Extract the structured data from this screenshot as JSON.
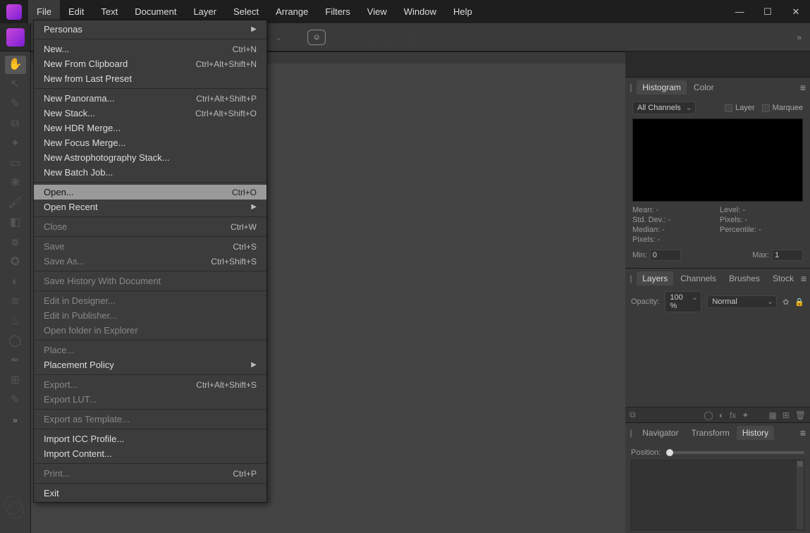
{
  "menubar": [
    "File",
    "Edit",
    "Text",
    "Document",
    "Layer",
    "Select",
    "Arrange",
    "Filters",
    "View",
    "Window",
    "Help"
  ],
  "dropdown": {
    "groups": [
      [
        {
          "label": "Personas",
          "submenu": true
        }
      ],
      [
        {
          "label": "New...",
          "shortcut": "Ctrl+N"
        },
        {
          "label": "New From Clipboard",
          "shortcut": "Ctrl+Alt+Shift+N"
        },
        {
          "label": "New from Last Preset"
        }
      ],
      [
        {
          "label": "New Panorama...",
          "shortcut": "Ctrl+Alt+Shift+P"
        },
        {
          "label": "New Stack...",
          "shortcut": "Ctrl+Alt+Shift+O"
        },
        {
          "label": "New HDR Merge..."
        },
        {
          "label": "New Focus Merge..."
        },
        {
          "label": "New Astrophotography Stack..."
        },
        {
          "label": "New Batch Job..."
        }
      ],
      [
        {
          "label": "Open...",
          "shortcut": "Ctrl+O",
          "hover": true
        },
        {
          "label": "Open Recent",
          "submenu": true
        }
      ],
      [
        {
          "label": "Close",
          "shortcut": "Ctrl+W",
          "disabled": true
        }
      ],
      [
        {
          "label": "Save",
          "shortcut": "Ctrl+S",
          "disabled": true
        },
        {
          "label": "Save As...",
          "shortcut": "Ctrl+Shift+S",
          "disabled": true
        }
      ],
      [
        {
          "label": "Save History With Document",
          "disabled": true
        }
      ],
      [
        {
          "label": "Edit in Designer...",
          "disabled": true
        },
        {
          "label": "Edit in Publisher...",
          "disabled": true
        },
        {
          "label": "Open folder in Explorer",
          "disabled": true
        }
      ],
      [
        {
          "label": "Place...",
          "disabled": true
        },
        {
          "label": "Placement Policy",
          "submenu": true
        }
      ],
      [
        {
          "label": "Export...",
          "shortcut": "Ctrl+Alt+Shift+S",
          "disabled": true
        },
        {
          "label": "Export LUT...",
          "disabled": true
        }
      ],
      [
        {
          "label": "Export as Template...",
          "disabled": true
        }
      ],
      [
        {
          "label": "Import ICC Profile..."
        },
        {
          "label": "Import Content..."
        }
      ],
      [
        {
          "label": "Print...",
          "shortcut": "Ctrl+P",
          "disabled": true
        }
      ],
      [
        {
          "label": "Exit"
        }
      ]
    ]
  },
  "tools": [
    {
      "name": "hand-tool",
      "glyph": "✋",
      "active": true
    },
    {
      "name": "move-tool",
      "glyph": "↖"
    },
    {
      "name": "color-picker",
      "glyph": "✎"
    },
    {
      "name": "crop-tool",
      "glyph": "⧉"
    },
    {
      "name": "selection-brush",
      "glyph": "✦"
    },
    {
      "name": "marquee",
      "glyph": "▭"
    },
    {
      "name": "flood-select",
      "glyph": "❋"
    },
    {
      "name": "paint-brush",
      "glyph": "🖌"
    },
    {
      "name": "erase",
      "glyph": "◧"
    },
    {
      "name": "clone",
      "glyph": "⧇"
    },
    {
      "name": "inpaint",
      "glyph": "✪"
    },
    {
      "name": "dodge",
      "glyph": "◐"
    },
    {
      "name": "smudge",
      "glyph": "≋"
    },
    {
      "name": "blur",
      "glyph": "♨"
    },
    {
      "name": "sponge",
      "glyph": "◯"
    },
    {
      "name": "pen",
      "glyph": "✒"
    },
    {
      "name": "mesh",
      "glyph": "⊞"
    },
    {
      "name": "text",
      "glyph": "✎"
    }
  ],
  "tools_expand": "»",
  "panels": {
    "histogram": {
      "tabs": [
        "Histogram",
        "Color"
      ],
      "active": "Histogram",
      "channel": "All Channels",
      "layer_label": "Layer",
      "marquee_label": "Marquee",
      "stats": {
        "mean": "Mean: -",
        "level": "Level: -",
        "stddev": "Std. Dev.: -",
        "pixels2": "Pixels: -",
        "median": "Median: -",
        "percentile": "Percentile: -",
        "pixels": "Pixels: -"
      },
      "min_label": "Min:",
      "min_val": "0",
      "max_label": "Max:",
      "max_val": "1"
    },
    "layers": {
      "tabs": [
        "Layers",
        "Channels",
        "Brushes",
        "Stock"
      ],
      "active": "Layers",
      "opacity_label": "Opacity:",
      "opacity_val": "100 %",
      "blend": "Normal"
    },
    "history": {
      "tabs": [
        "Navigator",
        "Transform",
        "History"
      ],
      "active": "History",
      "position_label": "Position:"
    }
  },
  "toolbar_chevron": "»"
}
